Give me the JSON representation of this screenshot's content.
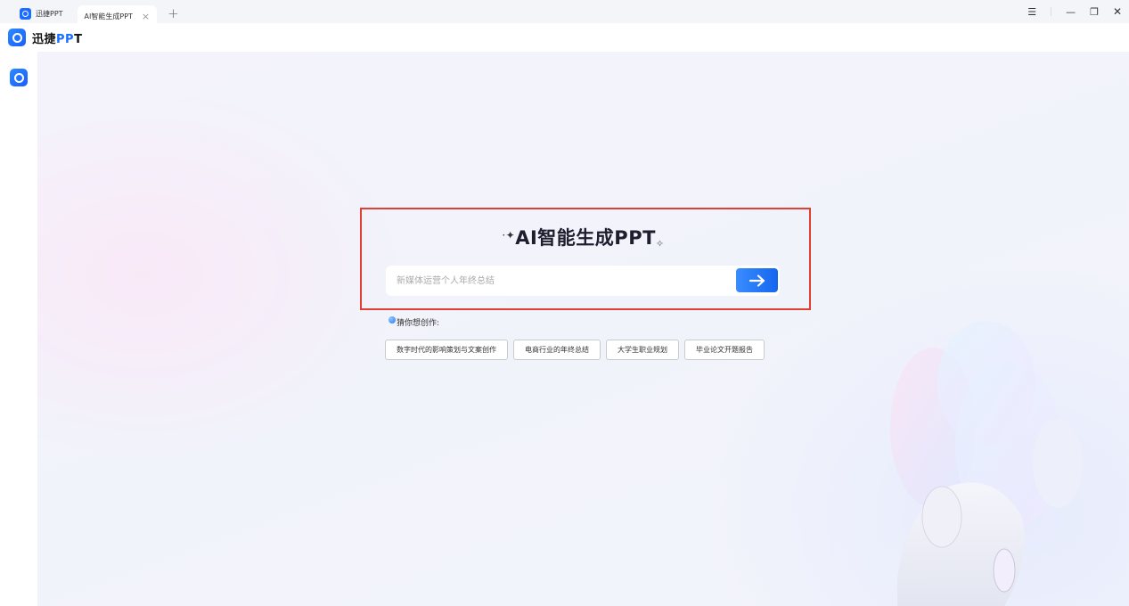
{
  "tabs": [
    {
      "label": "迅捷PPT",
      "icon": "app-logo-icon"
    },
    {
      "label": "AI智能生成PPT",
      "active": true
    }
  ],
  "tab_close_glyph": "×",
  "tab_add_glyph": "+",
  "window_controls": {
    "menu": "☰",
    "minimize": "—",
    "restore": "❐",
    "close": "✕"
  },
  "brand": {
    "prefix": "迅捷",
    "ppt": "PP",
    "suffix": "T"
  },
  "main": {
    "title": "AI智能生成PPT",
    "title_spark_left": "·✦",
    "title_spark_right": "✧",
    "search": {
      "placeholder": "新媒体运营个人年终总结",
      "value": ""
    },
    "guess_label": "猜你想创作:",
    "suggestions": [
      "数字时代的影响策划与文案创作",
      "电商行业的年终总结",
      "大学生职业规划",
      "毕业论文开题报告"
    ]
  },
  "colors": {
    "accent": "#1a6dff",
    "highlight_border": "#e04033",
    "background": "#f2f3fb"
  }
}
